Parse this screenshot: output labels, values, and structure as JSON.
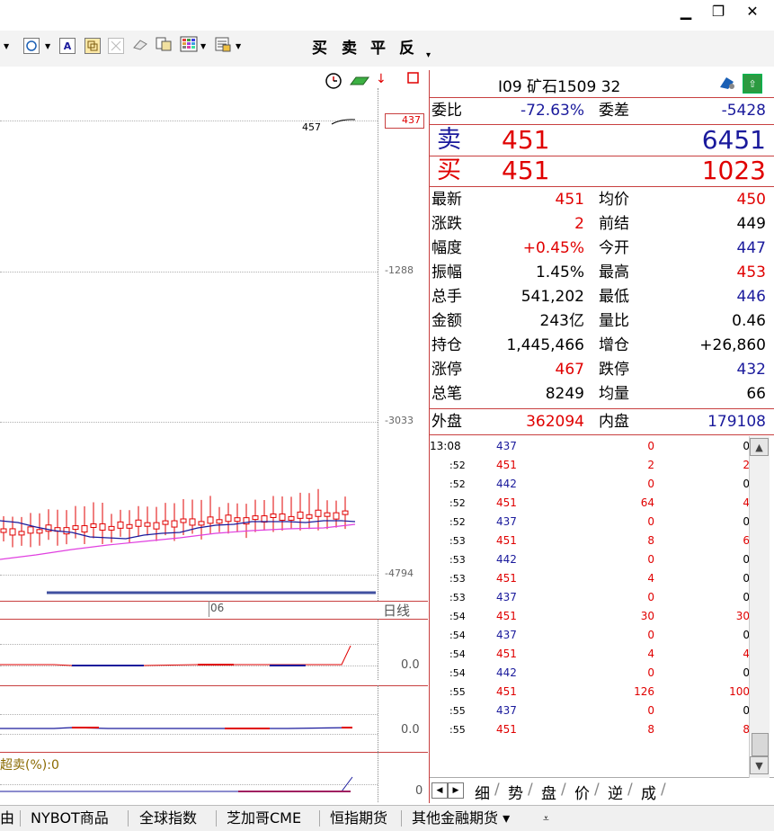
{
  "window": {
    "minimize_icon": "minimize-icon",
    "restore_icon": "restore-icon",
    "close_icon": "close-icon"
  },
  "toolbar": {
    "icons": [
      "ellipse-icon",
      "text-icon",
      "copy-icon",
      "disabled-icon",
      "eraser-icon",
      "paste-icon",
      "grid-icon",
      "template-icon"
    ],
    "text_box": "A",
    "trade_buttons": [
      "买",
      "卖",
      "平",
      "反"
    ]
  },
  "chart": {
    "y_labels": [
      "437",
      "-1288",
      "-3033",
      "-4794"
    ],
    "annotation": "457",
    "x_label": "06",
    "period": "日线",
    "indicator1_value": "0.0",
    "indicator2_value": "0.0",
    "indicator3_value": "0",
    "indicator3_label": "超卖(%):0",
    "status_icons": [
      "clock-icon",
      "network-icon",
      "arrow-icon",
      "window-icon"
    ]
  },
  "quote": {
    "title": "I09  矿石1509  32",
    "weibi_label": "委比",
    "weibi_value": "-72.63%",
    "weicha_label": "委差",
    "weicha_value": "-5428",
    "sell_label": "卖",
    "sell_price": "451",
    "sell_volume": "6451",
    "buy_label": "买",
    "buy_price": "451",
    "buy_volume": "1023",
    "stats": [
      {
        "l1": "最新",
        "v1": "451",
        "c1": "red",
        "l2": "均价",
        "v2": "450",
        "c2": "red"
      },
      {
        "l1": "涨跌",
        "v1": "2",
        "c1": "red",
        "l2": "前结",
        "v2": "449",
        "c2": "black"
      },
      {
        "l1": "幅度",
        "v1": "+0.45%",
        "c1": "red",
        "l2": "今开",
        "v2": "447",
        "c2": "blue"
      },
      {
        "l1": "振幅",
        "v1": "1.45%",
        "c1": "black",
        "l2": "最高",
        "v2": "453",
        "c2": "red"
      },
      {
        "l1": "总手",
        "v1": "541,202",
        "c1": "black",
        "l2": "最低",
        "v2": "446",
        "c2": "blue"
      },
      {
        "l1": "金额",
        "v1": "243亿",
        "c1": "black",
        "l2": "量比",
        "v2": "0.46",
        "c2": "black"
      },
      {
        "l1": "持仓",
        "v1": "1,445,466",
        "c1": "black",
        "l2": "增仓",
        "v2": "+26,860",
        "c2": "black"
      },
      {
        "l1": "涨停",
        "v1": "467",
        "c1": "red",
        "l2": "跌停",
        "v2": "432",
        "c2": "blue"
      },
      {
        "l1": "总笔",
        "v1": "8249",
        "c1": "black",
        "l2": "均量",
        "v2": "66",
        "c2": "black"
      }
    ],
    "waipan_label": "外盘",
    "waipan_value": "362094",
    "neipan_label": "内盘",
    "neipan_value": "179108",
    "ticks": [
      {
        "t": "13:08",
        "p": "437",
        "pc": "blue",
        "v": "0",
        "vc": "red",
        "x": "0",
        "xc": "black"
      },
      {
        "t": ":52",
        "p": "451",
        "pc": "red",
        "v": "2",
        "vc": "red",
        "x": "2",
        "xc": "red"
      },
      {
        "t": ":52",
        "p": "442",
        "pc": "blue",
        "v": "0",
        "vc": "red",
        "x": "0",
        "xc": "black"
      },
      {
        "t": ":52",
        "p": "451",
        "pc": "red",
        "v": "64",
        "vc": "red",
        "x": "4",
        "xc": "red"
      },
      {
        "t": ":52",
        "p": "437",
        "pc": "blue",
        "v": "0",
        "vc": "red",
        "x": "0",
        "xc": "black"
      },
      {
        "t": ":53",
        "p": "451",
        "pc": "red",
        "v": "8",
        "vc": "red",
        "x": "6",
        "xc": "red"
      },
      {
        "t": ":53",
        "p": "442",
        "pc": "blue",
        "v": "0",
        "vc": "red",
        "x": "0",
        "xc": "black"
      },
      {
        "t": ":53",
        "p": "451",
        "pc": "red",
        "v": "4",
        "vc": "red",
        "x": "0",
        "xc": "black"
      },
      {
        "t": ":53",
        "p": "437",
        "pc": "blue",
        "v": "0",
        "vc": "red",
        "x": "0",
        "xc": "black"
      },
      {
        "t": ":54",
        "p": "451",
        "pc": "red",
        "v": "30",
        "vc": "red",
        "x": "30",
        "xc": "red"
      },
      {
        "t": ":54",
        "p": "437",
        "pc": "blue",
        "v": "0",
        "vc": "red",
        "x": "0",
        "xc": "black"
      },
      {
        "t": ":54",
        "p": "451",
        "pc": "red",
        "v": "4",
        "vc": "red",
        "x": "4",
        "xc": "red"
      },
      {
        "t": ":54",
        "p": "442",
        "pc": "blue",
        "v": "0",
        "vc": "red",
        "x": "0",
        "xc": "black"
      },
      {
        "t": ":55",
        "p": "451",
        "pc": "red",
        "v": "126",
        "vc": "red",
        "x": "100",
        "xc": "red"
      },
      {
        "t": ":55",
        "p": "437",
        "pc": "blue",
        "v": "0",
        "vc": "red",
        "x": "0",
        "xc": "black"
      },
      {
        "t": ":55",
        "p": "451",
        "pc": "red",
        "v": "8",
        "vc": "red",
        "x": "8",
        "xc": "red"
      }
    ],
    "bottom_tabs": [
      "细",
      "势",
      "盘",
      "价",
      "逆",
      "成"
    ]
  },
  "statusbar": {
    "items": [
      "由",
      "NYBOT商品",
      "全球指数",
      "芝加哥CME",
      "恒指期货",
      "其他金融期货 ▾"
    ]
  },
  "colors": {
    "red": "#e00000",
    "blue": "#1a1a9c",
    "magenta": "#e040e0",
    "border": "#c84040"
  }
}
